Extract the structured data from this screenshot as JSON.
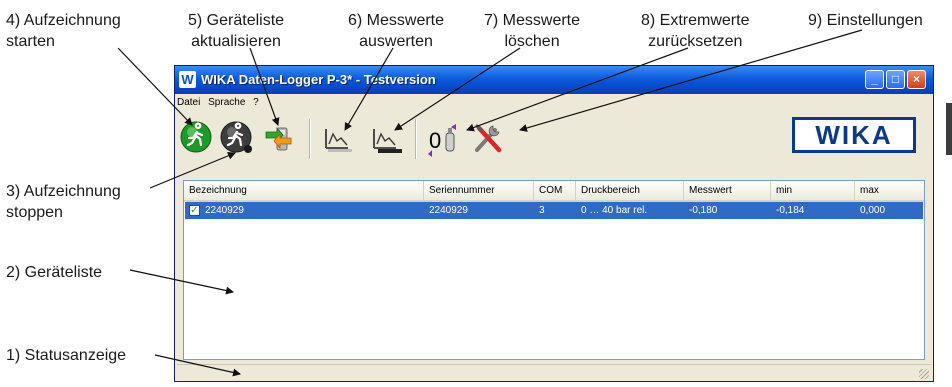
{
  "callouts": {
    "c4": [
      "4) Aufzeichnung",
      "starten"
    ],
    "c5": [
      "5) Geräteliste",
      "aktualisieren"
    ],
    "c6": [
      "6) Messwerte",
      "auswerten"
    ],
    "c7": [
      "7) Messwerte",
      "löschen"
    ],
    "c8": [
      "8) Extremwerte",
      "zurücksetzen"
    ],
    "c9": "9) Einstellungen",
    "c3": [
      "3) Aufzeichnung",
      "stoppen"
    ],
    "c2": "2) Geräteliste",
    "c1": "1) Statusanzeige"
  },
  "window": {
    "logo": "W",
    "title": "WIKA Daten-Logger P-3* - Testversion",
    "buttons": {
      "minimize": "_",
      "maximize": "□",
      "close": "×"
    }
  },
  "menu": [
    "Datei",
    "Sprache",
    "?"
  ],
  "toolbar": {
    "icons": [
      "start-record-icon",
      "stop-record-icon",
      "refresh-device-list-icon",
      "evaluate-values-icon",
      "delete-values-icon",
      "reset-extremes-icon",
      "settings-icon"
    ],
    "reset_label": "0"
  },
  "brand": "WIKA",
  "list": {
    "columns": [
      "Bezeichnung",
      "Seriennummer",
      "COM",
      "Druckbereich",
      "Messwert",
      "min",
      "max"
    ],
    "rows": [
      {
        "checked": true,
        "cells": [
          "2240929",
          "2240929",
          "3",
          "0 … 40 bar rel.",
          "-0,180",
          "-0,184",
          "0,000"
        ]
      }
    ]
  },
  "colors": {
    "title_bar": "#0b5bdc",
    "selection": "#316ac5",
    "window_bg": "#ece9d8",
    "brand": "#0b3a8c"
  }
}
